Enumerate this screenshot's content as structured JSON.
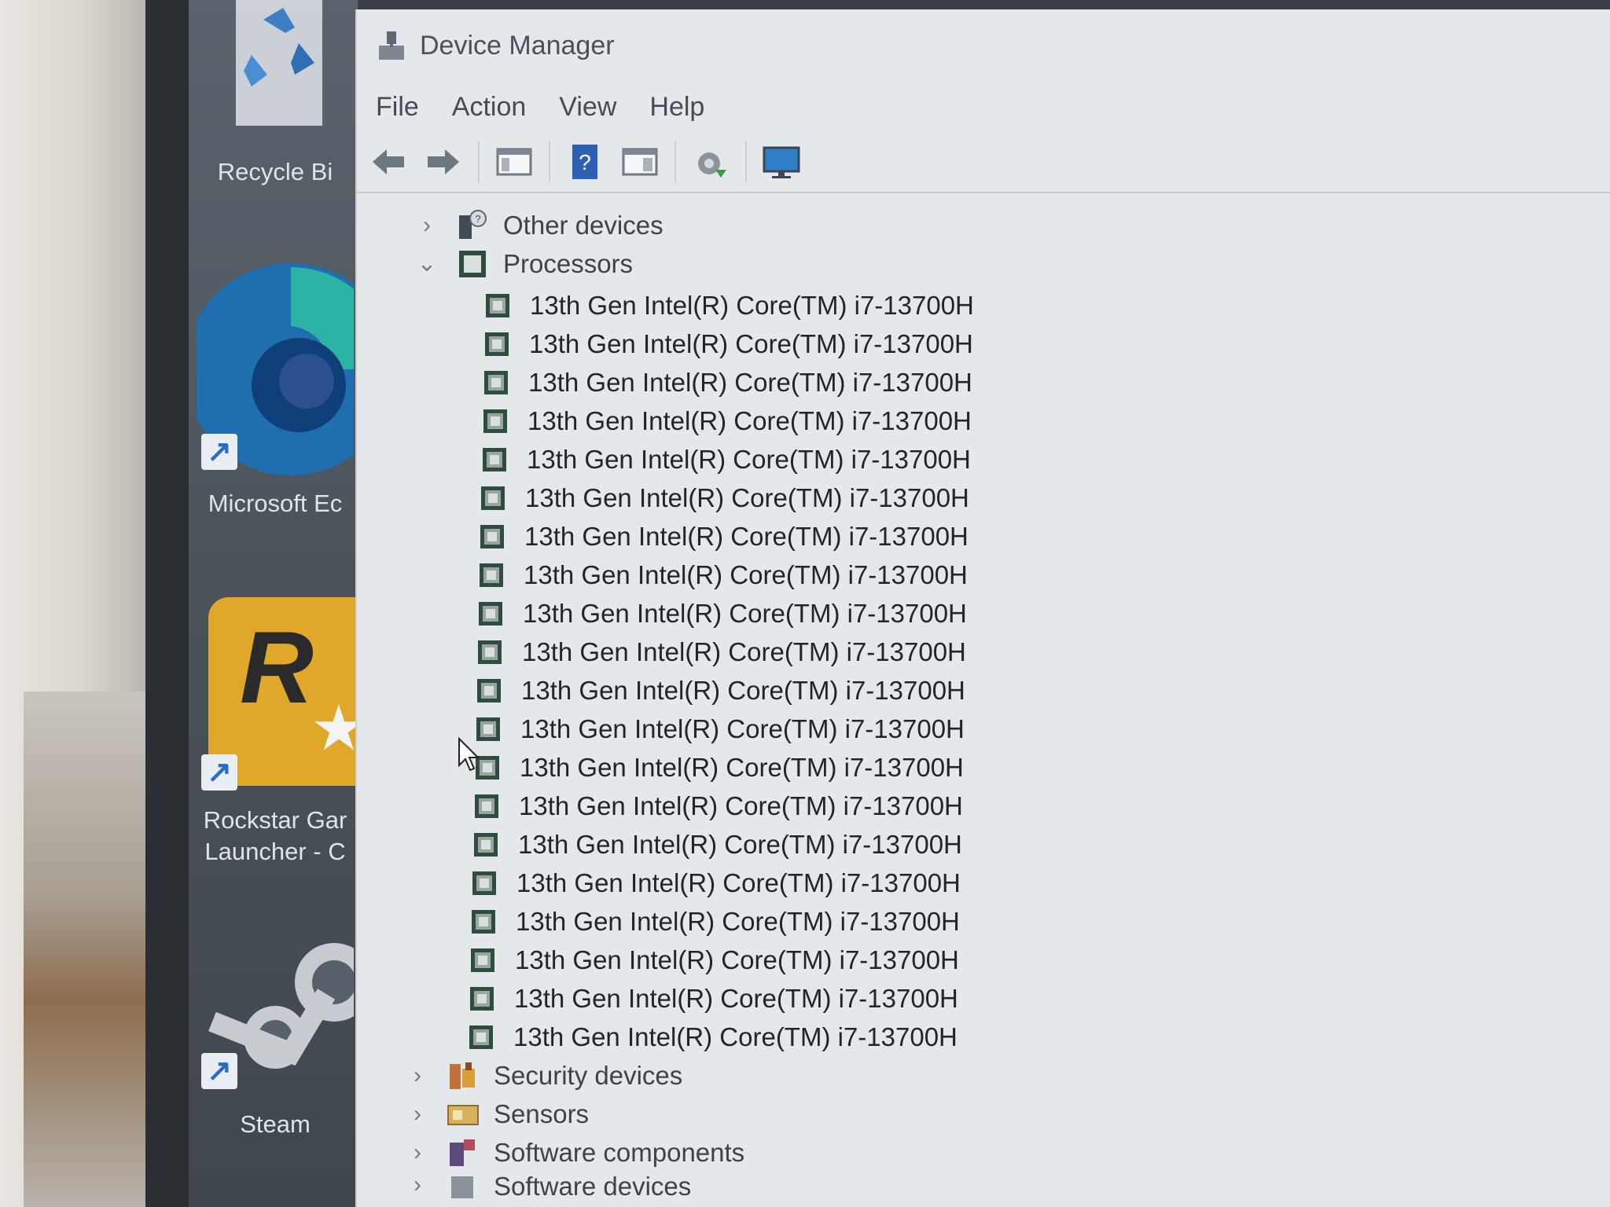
{
  "desktop": {
    "icons": [
      {
        "label": "Recycle Bi"
      },
      {
        "label": "Microsoft Ec"
      },
      {
        "label": "Rockstar Gar",
        "label2": "Launcher - C"
      },
      {
        "label": "Steam"
      }
    ]
  },
  "window": {
    "title": "Device Manager",
    "menu": [
      "File",
      "Action",
      "View",
      "Help"
    ]
  },
  "tree": {
    "other_devices": "Other devices",
    "processors": "Processors",
    "processor_items": [
      "13th Gen Intel(R) Core(TM) i7-13700H",
      "13th Gen Intel(R) Core(TM) i7-13700H",
      "13th Gen Intel(R) Core(TM) i7-13700H",
      "13th Gen Intel(R) Core(TM) i7-13700H",
      "13th Gen Intel(R) Core(TM) i7-13700H",
      "13th Gen Intel(R) Core(TM) i7-13700H",
      "13th Gen Intel(R) Core(TM) i7-13700H",
      "13th Gen Intel(R) Core(TM) i7-13700H",
      "13th Gen Intel(R) Core(TM) i7-13700H",
      "13th Gen Intel(R) Core(TM) i7-13700H",
      "13th Gen Intel(R) Core(TM) i7-13700H",
      "13th Gen Intel(R) Core(TM) i7-13700H",
      "13th Gen Intel(R) Core(TM) i7-13700H",
      "13th Gen Intel(R) Core(TM) i7-13700H",
      "13th Gen Intel(R) Core(TM) i7-13700H",
      "13th Gen Intel(R) Core(TM) i7-13700H",
      "13th Gen Intel(R) Core(TM) i7-13700H",
      "13th Gen Intel(R) Core(TM) i7-13700H",
      "13th Gen Intel(R) Core(TM) i7-13700H",
      "13th Gen Intel(R) Core(TM) i7-13700H"
    ],
    "security_devices": "Security devices",
    "sensors": "Sensors",
    "software_components": "Software components",
    "software_devices": "Software devices"
  }
}
